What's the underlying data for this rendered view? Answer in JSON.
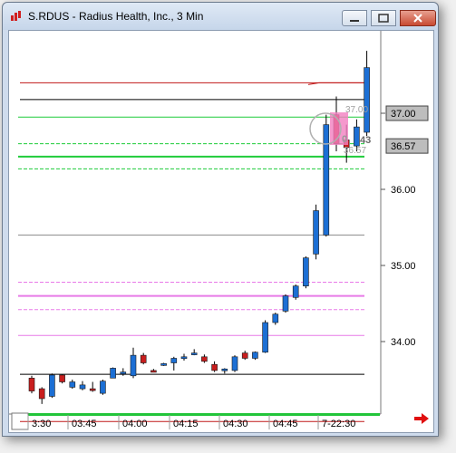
{
  "window": {
    "title": "S.RDUS - Radius Health, Inc., 3 Min",
    "minimize_glyph": "▭",
    "maximize_glyph": "▢",
    "close_glyph": "✕"
  },
  "colors": {
    "up_candle": "#1c6fd4",
    "down_candle": "#c81e1e",
    "red_line": "#c01818",
    "black_line": "#000000",
    "green_line": "#1fcc3a",
    "magenta_line": "#e87ae8",
    "gray_line": "#8c8c8c",
    "price_box": "#bdbdbd"
  },
  "price_axis": {
    "ticks": [
      "37.00",
      "36.00",
      "35.00",
      "34.00"
    ],
    "tick_values": [
      37.0,
      36.0,
      35.0,
      34.0
    ],
    "boxes": [
      {
        "label": "37.00",
        "value": 37.0
      },
      {
        "label": "36.57",
        "value": 36.57
      }
    ]
  },
  "time_axis": {
    "labels": [
      "3:30",
      "03:45",
      "04:00",
      "04:15",
      "04:30",
      "04:45",
      "7-22:30"
    ]
  },
  "overlay_labels": {
    "upper": "37.00",
    "mid": "43",
    "lower": "36.57",
    "partial": "0"
  },
  "chart_data": {
    "type": "candlestick",
    "symbol": "S.RDUS",
    "interval": "3 Min",
    "ylim": [
      33.25,
      38.0
    ],
    "horizontal_levels": [
      {
        "value": 37.4,
        "color": "red",
        "style": "solid"
      },
      {
        "value": 37.18,
        "color": "black",
        "style": "solid"
      },
      {
        "value": 36.95,
        "color": "green",
        "style": "solid"
      },
      {
        "value": 36.6,
        "color": "green",
        "style": "dashed"
      },
      {
        "value": 36.43,
        "color": "green",
        "style": "solid-thick"
      },
      {
        "value": 36.27,
        "color": "green",
        "style": "dashed"
      },
      {
        "value": 35.4,
        "color": "gray",
        "style": "solid"
      },
      {
        "value": 34.78,
        "color": "magenta",
        "style": "dashed"
      },
      {
        "value": 34.6,
        "color": "magenta",
        "style": "solid-thick"
      },
      {
        "value": 34.42,
        "color": "magenta",
        "style": "dashed"
      },
      {
        "value": 34.08,
        "color": "magenta",
        "style": "solid"
      },
      {
        "value": 33.57,
        "color": "black",
        "style": "solid"
      },
      {
        "value": 32.95,
        "color": "red",
        "style": "solid"
      }
    ],
    "candles": [
      {
        "o": 33.52,
        "h": 33.55,
        "l": 33.32,
        "c": 33.35,
        "dir": "down"
      },
      {
        "o": 33.38,
        "h": 33.4,
        "l": 33.18,
        "c": 33.25,
        "dir": "down"
      },
      {
        "o": 33.28,
        "h": 33.58,
        "l": 33.26,
        "c": 33.56,
        "dir": "up"
      },
      {
        "o": 33.56,
        "h": 33.57,
        "l": 33.45,
        "c": 33.47,
        "dir": "down"
      },
      {
        "o": 33.47,
        "h": 33.5,
        "l": 33.38,
        "c": 33.4,
        "dir": "up"
      },
      {
        "o": 33.43,
        "h": 33.48,
        "l": 33.36,
        "c": 33.38,
        "dir": "up"
      },
      {
        "o": 33.38,
        "h": 33.47,
        "l": 33.34,
        "c": 33.36,
        "dir": "down"
      },
      {
        "o": 33.32,
        "h": 33.5,
        "l": 33.3,
        "c": 33.48,
        "dir": "up"
      },
      {
        "o": 33.52,
        "h": 33.66,
        "l": 33.52,
        "c": 33.65,
        "dir": "up"
      },
      {
        "o": 33.6,
        "h": 33.65,
        "l": 33.55,
        "c": 33.58,
        "dir": "up"
      },
      {
        "o": 33.55,
        "h": 33.92,
        "l": 33.52,
        "c": 33.82,
        "dir": "up"
      },
      {
        "o": 33.82,
        "h": 33.85,
        "l": 33.7,
        "c": 33.72,
        "dir": "down"
      },
      {
        "o": 33.62,
        "h": 33.64,
        "l": 33.6,
        "c": 33.61,
        "dir": "down"
      },
      {
        "o": 33.7,
        "h": 33.72,
        "l": 33.68,
        "c": 33.71,
        "dir": "up"
      },
      {
        "o": 33.72,
        "h": 33.8,
        "l": 33.62,
        "c": 33.78,
        "dir": "up"
      },
      {
        "o": 33.78,
        "h": 33.84,
        "l": 33.75,
        "c": 33.8,
        "dir": "up"
      },
      {
        "o": 33.84,
        "h": 33.9,
        "l": 33.82,
        "c": 33.85,
        "dir": "up"
      },
      {
        "o": 33.8,
        "h": 33.83,
        "l": 33.72,
        "c": 33.74,
        "dir": "down"
      },
      {
        "o": 33.7,
        "h": 33.74,
        "l": 33.6,
        "c": 33.62,
        "dir": "down"
      },
      {
        "o": 33.63,
        "h": 33.65,
        "l": 33.58,
        "c": 33.64,
        "dir": "up"
      },
      {
        "o": 33.62,
        "h": 33.82,
        "l": 33.6,
        "c": 33.8,
        "dir": "up"
      },
      {
        "o": 33.85,
        "h": 33.88,
        "l": 33.76,
        "c": 33.78,
        "dir": "down"
      },
      {
        "o": 33.78,
        "h": 33.87,
        "l": 33.76,
        "c": 33.86,
        "dir": "up"
      },
      {
        "o": 33.86,
        "h": 34.28,
        "l": 33.85,
        "c": 34.25,
        "dir": "up"
      },
      {
        "o": 34.25,
        "h": 34.38,
        "l": 34.22,
        "c": 34.36,
        "dir": "up"
      },
      {
        "o": 34.4,
        "h": 34.62,
        "l": 34.38,
        "c": 34.6,
        "dir": "up"
      },
      {
        "o": 34.58,
        "h": 34.75,
        "l": 34.55,
        "c": 34.73,
        "dir": "up"
      },
      {
        "o": 34.73,
        "h": 35.12,
        "l": 34.7,
        "c": 35.1,
        "dir": "up"
      },
      {
        "o": 35.15,
        "h": 35.8,
        "l": 35.08,
        "c": 35.72,
        "dir": "up"
      },
      {
        "o": 35.4,
        "h": 36.98,
        "l": 35.38,
        "c": 36.85,
        "dir": "up"
      },
      {
        "o": 36.98,
        "h": 37.22,
        "l": 36.5,
        "c": 36.6,
        "dir": "down"
      },
      {
        "o": 36.65,
        "h": 36.85,
        "l": 36.35,
        "c": 36.55,
        "dir": "down"
      },
      {
        "o": 36.57,
        "h": 36.92,
        "l": 36.5,
        "c": 36.82,
        "dir": "up"
      },
      {
        "o": 36.75,
        "h": 37.82,
        "l": 36.7,
        "c": 37.6,
        "dir": "up"
      }
    ]
  }
}
